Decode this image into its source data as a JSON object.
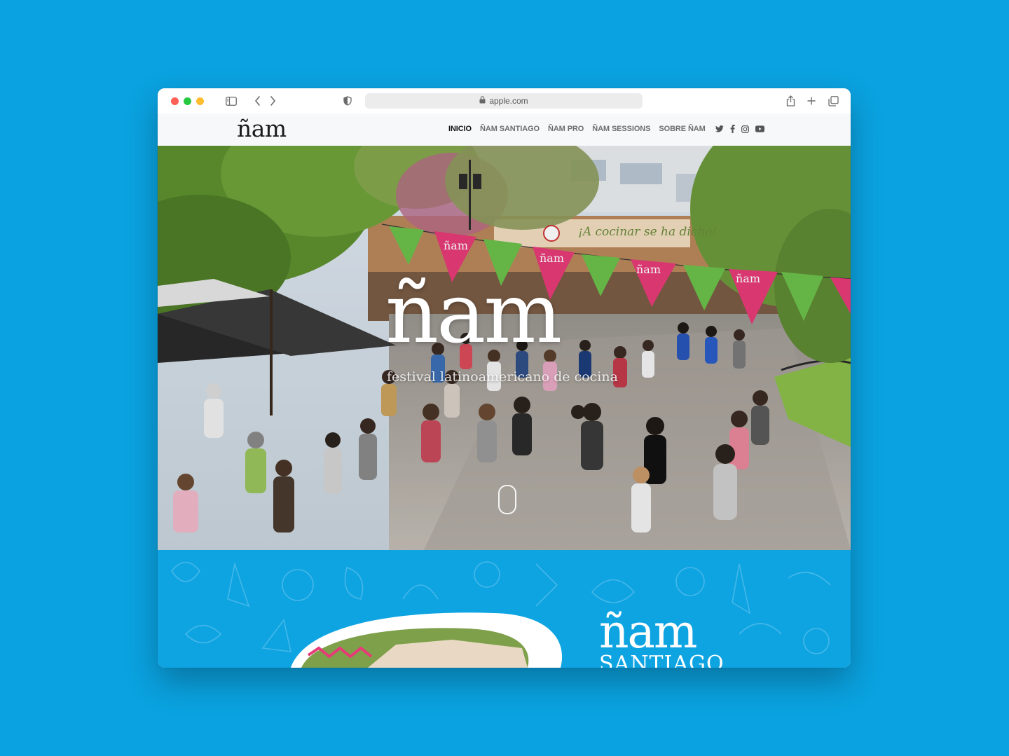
{
  "browser": {
    "url": "apple.com",
    "icons": [
      "sidebar-icon",
      "back-icon",
      "forward-icon",
      "shield-icon",
      "lock-icon",
      "share-icon",
      "new-tab-icon",
      "tabs-overview-icon"
    ]
  },
  "site": {
    "logo": "ñam",
    "nav": [
      {
        "label": "INICIO",
        "active": true
      },
      {
        "label": "ÑAM SANTIAGO",
        "active": false
      },
      {
        "label": "ÑAM PRO",
        "active": false
      },
      {
        "label": "ÑAM SESSIONS",
        "active": false
      },
      {
        "label": "SOBRE ÑAM",
        "active": false
      }
    ],
    "social": [
      "twitter-icon",
      "facebook-icon",
      "instagram-icon",
      "youtube-icon"
    ]
  },
  "hero": {
    "title": "ñam",
    "subtitle": "festival latinoamericano de cocina",
    "banner_text": "ñam",
    "sign_text": "¡A cocinar se ha dicho!",
    "colors": {
      "pennant_pink": "#e63b78",
      "pennant_green": "#6cc14b"
    }
  },
  "section": {
    "title": "ñam",
    "subtitle": "SANTIAGO",
    "background_color": "#0ea4e2"
  }
}
